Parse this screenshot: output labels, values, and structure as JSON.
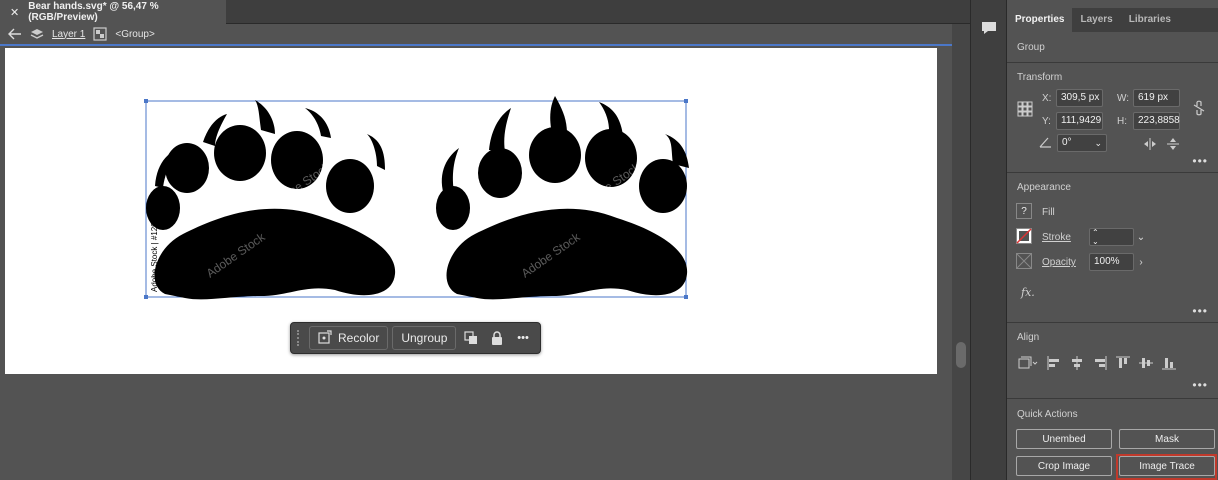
{
  "document": {
    "tab_title": "Bear hands.svg* @ 56,47 % (RGB/Preview)",
    "close_glyph": "✕"
  },
  "breadcrumb": {
    "layer": "Layer 1",
    "group": "<Group>"
  },
  "artwork": {
    "watermark": "Adobe Stock",
    "side_text": "Adobe Stock | #1204949"
  },
  "context_bar": {
    "recolor_label": "Recolor",
    "ungroup_label": "Ungroup",
    "more_glyph": "•••"
  },
  "panel": {
    "tabs": [
      "Properties",
      "Layers",
      "Libraries"
    ],
    "active_tab": "Properties",
    "object_type": "Group",
    "transform": {
      "title": "Transform",
      "x_label": "X:",
      "x_value": "309,5 px",
      "y_label": "Y:",
      "y_value": "111,9429",
      "w_label": "W:",
      "w_value": "619 px",
      "h_label": "H:",
      "h_value": "223,8858",
      "angle_value": "0°"
    },
    "appearance": {
      "title": "Appearance",
      "fill_label": "Fill",
      "stroke_label": "Stroke",
      "opacity_label": "Opacity",
      "opacity_value": "100%",
      "fx_label": "fx."
    },
    "align": {
      "title": "Align"
    },
    "quick_actions": {
      "title": "Quick Actions",
      "unembed": "Unembed",
      "mask": "Mask",
      "crop_image": "Crop Image",
      "image_trace": "Image Trace"
    },
    "more_glyph": "•••"
  },
  "colors": {
    "selection": "#4b77c8",
    "highlight": "#c0392b",
    "panel_bg": "#535353"
  }
}
